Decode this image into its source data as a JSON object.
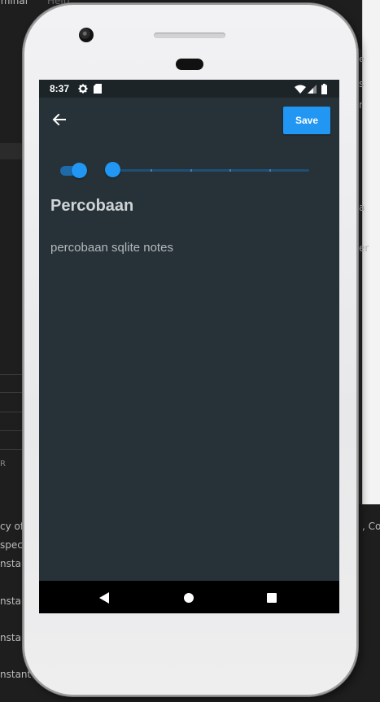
{
  "background_ide": {
    "menu_items": [
      "rminal",
      "Help"
    ],
    "snippets": [
      {
        "text": "cy of"
      },
      {
        "text": "spec"
      },
      {
        "text": "nstar"
      },
      {
        "text": "nstar"
      },
      {
        "text": "nstar"
      },
      {
        "text": "nstant"
      },
      {
        "text": "R"
      },
      {
        "text": ", Col"
      },
      {
        "text": "e"
      },
      {
        "text": "s"
      },
      {
        "text": "r"
      },
      {
        "text": "a"
      },
      {
        "text": "er"
      }
    ]
  },
  "status_bar": {
    "time": "8:37",
    "icons": [
      "settings-icon",
      "sd-card-icon",
      "wifi-icon",
      "signal-icon",
      "battery-icon"
    ]
  },
  "app_bar": {
    "back_icon": "arrow-back-icon",
    "save_label": "Save"
  },
  "controls": {
    "toggle_on": true,
    "slider_value_fraction": 0.0,
    "slider_divisions": 5
  },
  "note": {
    "title": "Percobaan",
    "content": "percobaan sqlite notes"
  },
  "nav_bar": {
    "buttons": [
      "back-triangle-icon",
      "home-circle-icon",
      "recents-square-icon"
    ]
  },
  "colors": {
    "accent": "#2196f3",
    "screen_background": "#263238",
    "status_bar": "#1c2428",
    "nav_bar": "#000000",
    "title_text": "#d0d4d6",
    "body_text": "#b3b9bc"
  }
}
